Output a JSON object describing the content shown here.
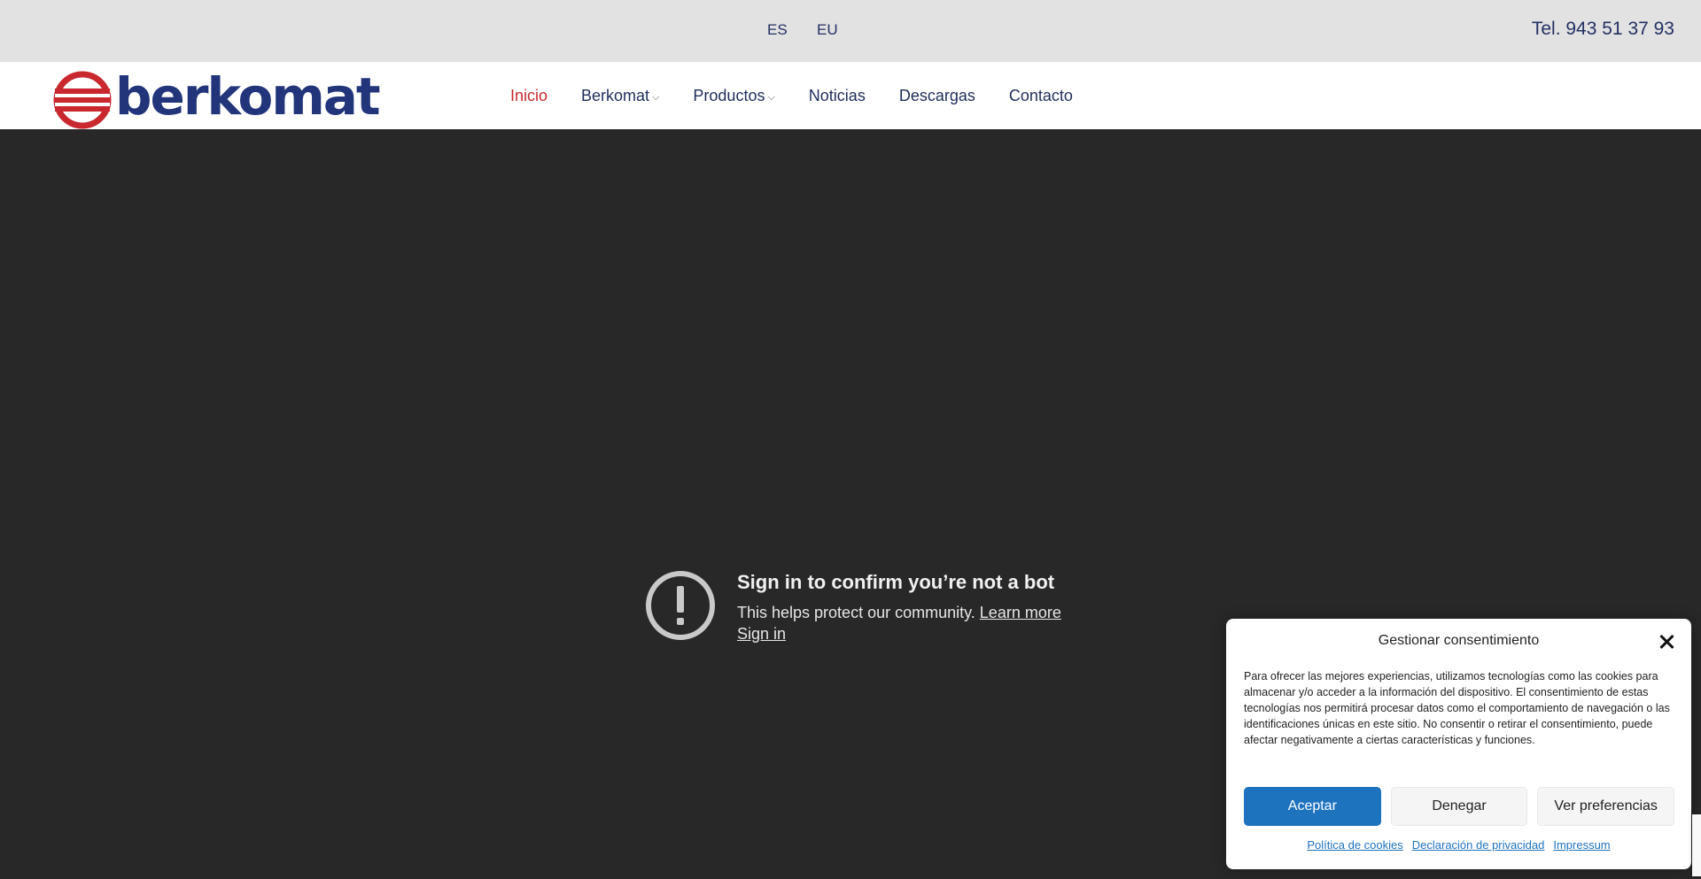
{
  "topbar": {
    "languages": [
      "ES",
      "EU"
    ],
    "phone": "Tel. 943 51 37 93"
  },
  "header": {
    "logo_text": "berkomat",
    "brand_colors": {
      "red": "#c8282e",
      "blue": "#22357a"
    },
    "nav": [
      {
        "label": "Inicio",
        "active": true,
        "dropdown": false
      },
      {
        "label": "Berkomat",
        "active": false,
        "dropdown": true
      },
      {
        "label": "Productos",
        "active": false,
        "dropdown": true
      },
      {
        "label": "Noticias",
        "active": false,
        "dropdown": false
      },
      {
        "label": "Descargas",
        "active": false,
        "dropdown": false
      },
      {
        "label": "Contacto",
        "active": false,
        "dropdown": false
      }
    ]
  },
  "video_error": {
    "icon": "exclamation-circle-icon",
    "title": "Sign in to confirm you’re not a bot",
    "subtitle": "This helps protect our community.",
    "learn_more": "Learn more",
    "sign_in": "Sign in"
  },
  "consent": {
    "title": "Gestionar consentimiento",
    "body": "Para ofrecer las mejores experiencias, utilizamos tecnologías como las cookies para almacenar y/o acceder a la información del dispositivo. El consentimiento de estas tecnologías nos permitirá procesar datos como el comportamiento de navegación o las identificaciones únicas en este sitio. No consentir o retirar el consentimiento, puede afectar negativamente a ciertas características y funciones.",
    "buttons": {
      "accept": "Aceptar",
      "deny": "Denegar",
      "preferences": "Ver preferencias"
    },
    "links": [
      "Política de cookies",
      "Declaración de privacidad",
      "Impressum"
    ],
    "accent_color": "#1e73be"
  }
}
